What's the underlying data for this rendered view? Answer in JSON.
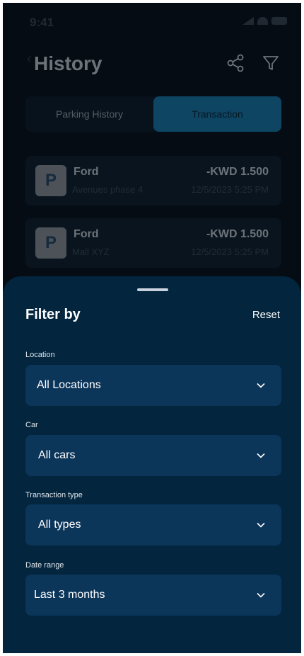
{
  "status_bar": {
    "time": "9:41"
  },
  "header": {
    "title": "History",
    "icons": [
      "back-arrow-icon",
      "share-icon",
      "filter-icon"
    ]
  },
  "segmented": {
    "tabs": [
      "Parking History",
      "Transaction"
    ],
    "active": "Transaction"
  },
  "transactions": [
    {
      "badge": "P",
      "car": "Ford",
      "location": "Avenues phase 4",
      "amount": "-KWD 1.500",
      "date": "12/5/2023 5:25 PM"
    },
    {
      "badge": "P",
      "car": "Ford",
      "location": "Mall XYZ",
      "amount": "-KWD 1.500",
      "date": "12/5/2023 5:25 PM"
    }
  ],
  "filter_sheet": {
    "title": "Filter by",
    "reset": "Reset",
    "fields": [
      {
        "label": "Location",
        "value": "All Locations"
      },
      {
        "label": "Car",
        "value": "All cars"
      },
      {
        "label": "Transaction type",
        "value": "All types"
      },
      {
        "label": "Date range",
        "value": "Last 3 months"
      }
    ]
  },
  "colors": {
    "sheet_bg": "#03253e",
    "select_bg": "#0c355a",
    "accent": "#1a7fb5"
  }
}
